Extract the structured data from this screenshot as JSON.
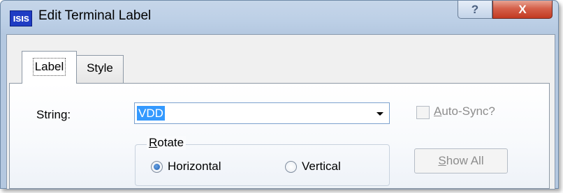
{
  "window": {
    "icon_text": "ısıs",
    "title": "Edit Terminal Label",
    "help_glyph": "?",
    "close_glyph": "X"
  },
  "tabs": [
    {
      "label": "Label",
      "active": true
    },
    {
      "label": "Style",
      "active": false
    }
  ],
  "label_tab": {
    "string_label": "String:",
    "string_value": "VDD",
    "auto_sync": {
      "label": "Auto-Sync?",
      "access_key": "A",
      "label_rest": "uto-Sync?",
      "checked": false,
      "enabled": false
    },
    "rotate": {
      "legend": "Rotate",
      "legend_key": "R",
      "legend_rest": "otate",
      "options": [
        {
          "label": "Horizontal",
          "selected": true
        },
        {
          "label": "Vertical",
          "selected": false
        }
      ]
    },
    "show_all": {
      "label": "Show All",
      "access_key": "S",
      "label_rest": "how All",
      "enabled": false
    }
  },
  "colors": {
    "icon_bg": "#1f3cc4",
    "selection": "#3399ff",
    "close_button": "#c23a22"
  }
}
